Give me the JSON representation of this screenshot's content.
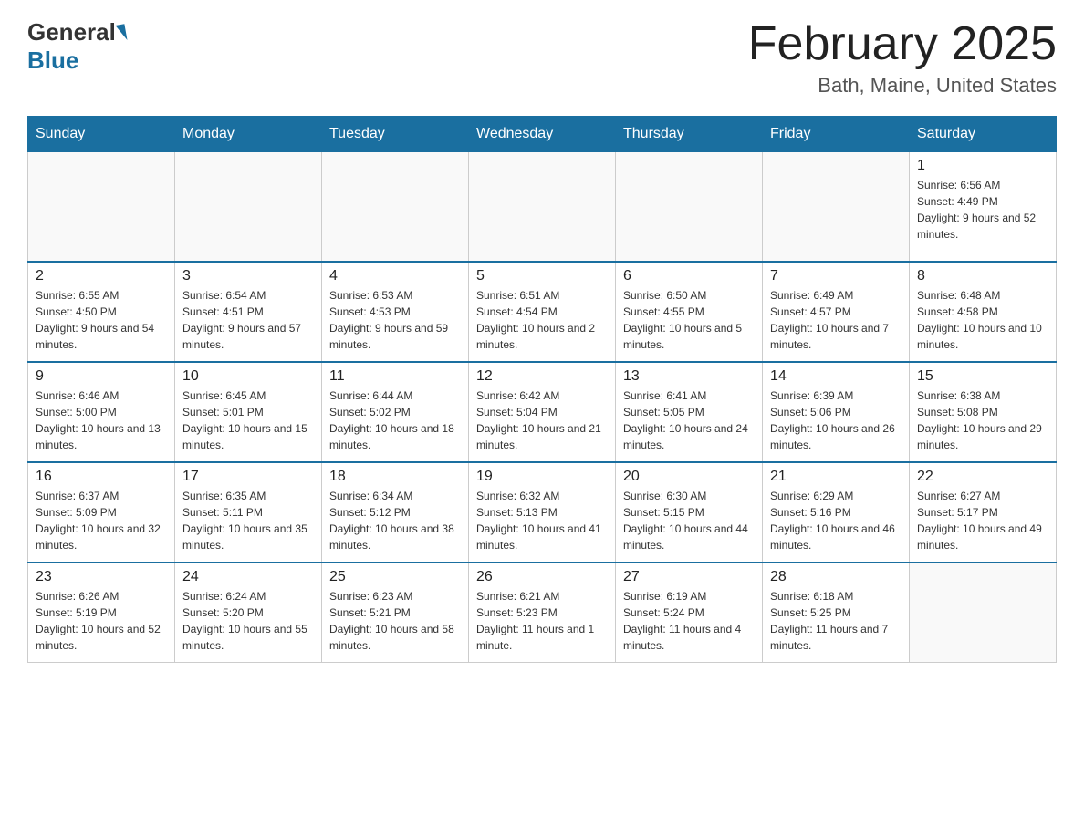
{
  "header": {
    "logo": {
      "general": "General",
      "blue": "Blue"
    },
    "title": "February 2025",
    "location": "Bath, Maine, United States"
  },
  "days_of_week": [
    "Sunday",
    "Monday",
    "Tuesday",
    "Wednesday",
    "Thursday",
    "Friday",
    "Saturday"
  ],
  "weeks": [
    {
      "days": [
        {
          "number": "",
          "info": ""
        },
        {
          "number": "",
          "info": ""
        },
        {
          "number": "",
          "info": ""
        },
        {
          "number": "",
          "info": ""
        },
        {
          "number": "",
          "info": ""
        },
        {
          "number": "",
          "info": ""
        },
        {
          "number": "1",
          "info": "Sunrise: 6:56 AM\nSunset: 4:49 PM\nDaylight: 9 hours and 52 minutes."
        }
      ]
    },
    {
      "days": [
        {
          "number": "2",
          "info": "Sunrise: 6:55 AM\nSunset: 4:50 PM\nDaylight: 9 hours and 54 minutes."
        },
        {
          "number": "3",
          "info": "Sunrise: 6:54 AM\nSunset: 4:51 PM\nDaylight: 9 hours and 57 minutes."
        },
        {
          "number": "4",
          "info": "Sunrise: 6:53 AM\nSunset: 4:53 PM\nDaylight: 9 hours and 59 minutes."
        },
        {
          "number": "5",
          "info": "Sunrise: 6:51 AM\nSunset: 4:54 PM\nDaylight: 10 hours and 2 minutes."
        },
        {
          "number": "6",
          "info": "Sunrise: 6:50 AM\nSunset: 4:55 PM\nDaylight: 10 hours and 5 minutes."
        },
        {
          "number": "7",
          "info": "Sunrise: 6:49 AM\nSunset: 4:57 PM\nDaylight: 10 hours and 7 minutes."
        },
        {
          "number": "8",
          "info": "Sunrise: 6:48 AM\nSunset: 4:58 PM\nDaylight: 10 hours and 10 minutes."
        }
      ]
    },
    {
      "days": [
        {
          "number": "9",
          "info": "Sunrise: 6:46 AM\nSunset: 5:00 PM\nDaylight: 10 hours and 13 minutes."
        },
        {
          "number": "10",
          "info": "Sunrise: 6:45 AM\nSunset: 5:01 PM\nDaylight: 10 hours and 15 minutes."
        },
        {
          "number": "11",
          "info": "Sunrise: 6:44 AM\nSunset: 5:02 PM\nDaylight: 10 hours and 18 minutes."
        },
        {
          "number": "12",
          "info": "Sunrise: 6:42 AM\nSunset: 5:04 PM\nDaylight: 10 hours and 21 minutes."
        },
        {
          "number": "13",
          "info": "Sunrise: 6:41 AM\nSunset: 5:05 PM\nDaylight: 10 hours and 24 minutes."
        },
        {
          "number": "14",
          "info": "Sunrise: 6:39 AM\nSunset: 5:06 PM\nDaylight: 10 hours and 26 minutes."
        },
        {
          "number": "15",
          "info": "Sunrise: 6:38 AM\nSunset: 5:08 PM\nDaylight: 10 hours and 29 minutes."
        }
      ]
    },
    {
      "days": [
        {
          "number": "16",
          "info": "Sunrise: 6:37 AM\nSunset: 5:09 PM\nDaylight: 10 hours and 32 minutes."
        },
        {
          "number": "17",
          "info": "Sunrise: 6:35 AM\nSunset: 5:11 PM\nDaylight: 10 hours and 35 minutes."
        },
        {
          "number": "18",
          "info": "Sunrise: 6:34 AM\nSunset: 5:12 PM\nDaylight: 10 hours and 38 minutes."
        },
        {
          "number": "19",
          "info": "Sunrise: 6:32 AM\nSunset: 5:13 PM\nDaylight: 10 hours and 41 minutes."
        },
        {
          "number": "20",
          "info": "Sunrise: 6:30 AM\nSunset: 5:15 PM\nDaylight: 10 hours and 44 minutes."
        },
        {
          "number": "21",
          "info": "Sunrise: 6:29 AM\nSunset: 5:16 PM\nDaylight: 10 hours and 46 minutes."
        },
        {
          "number": "22",
          "info": "Sunrise: 6:27 AM\nSunset: 5:17 PM\nDaylight: 10 hours and 49 minutes."
        }
      ]
    },
    {
      "days": [
        {
          "number": "23",
          "info": "Sunrise: 6:26 AM\nSunset: 5:19 PM\nDaylight: 10 hours and 52 minutes."
        },
        {
          "number": "24",
          "info": "Sunrise: 6:24 AM\nSunset: 5:20 PM\nDaylight: 10 hours and 55 minutes."
        },
        {
          "number": "25",
          "info": "Sunrise: 6:23 AM\nSunset: 5:21 PM\nDaylight: 10 hours and 58 minutes."
        },
        {
          "number": "26",
          "info": "Sunrise: 6:21 AM\nSunset: 5:23 PM\nDaylight: 11 hours and 1 minute."
        },
        {
          "number": "27",
          "info": "Sunrise: 6:19 AM\nSunset: 5:24 PM\nDaylight: 11 hours and 4 minutes."
        },
        {
          "number": "28",
          "info": "Sunrise: 6:18 AM\nSunset: 5:25 PM\nDaylight: 11 hours and 7 minutes."
        },
        {
          "number": "",
          "info": ""
        }
      ]
    }
  ]
}
